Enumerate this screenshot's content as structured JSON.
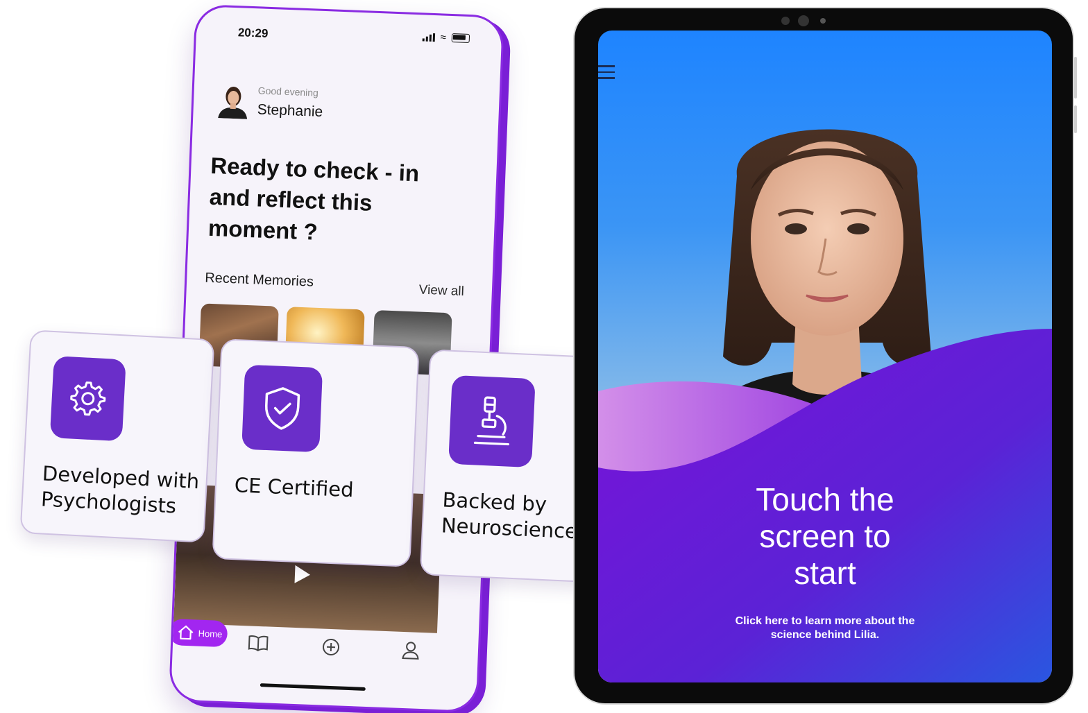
{
  "phone": {
    "status_time": "20:29",
    "greeting": "Good evening",
    "user_name": "Stephanie",
    "headline": "Ready to check - in and reflect this moment ?",
    "recent_title": "Recent Memories",
    "view_all": "View all",
    "tabs": [
      {
        "label": "Home",
        "icon": "home-icon"
      },
      {
        "label": "",
        "icon": "book-icon"
      },
      {
        "label": "",
        "icon": "plus-circle-icon"
      },
      {
        "label": "",
        "icon": "user-icon"
      }
    ]
  },
  "features": [
    {
      "label": "Developed with Psychologists",
      "icon": "gear-icon"
    },
    {
      "label": "CE Certified",
      "icon": "shield-check-icon"
    },
    {
      "label": "Backed by Neuroscience",
      "icon": "microscope-icon"
    }
  ],
  "tablet": {
    "cta_title": "Touch the screen to start",
    "cta_subtitle": "Click here to learn more about the science behind Lilia."
  },
  "colors": {
    "accent_purple": "#6a2ec9",
    "pill_purple": "#a226f0",
    "screen_blue": "#1e84ff"
  }
}
